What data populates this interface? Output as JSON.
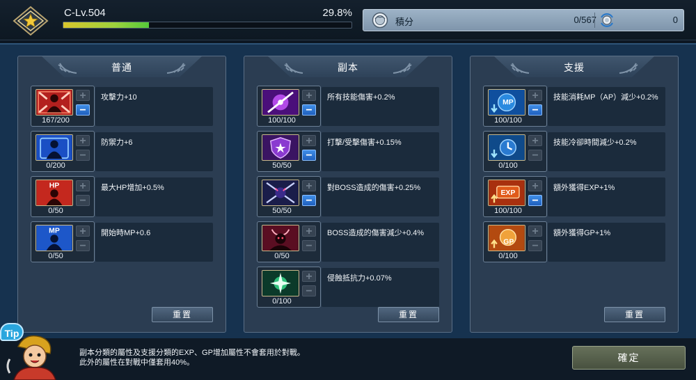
{
  "header": {
    "level_label": "C-Lv.504",
    "exp_percent_label": "29.8%",
    "exp_progress": 0.298,
    "points_label": "積分",
    "points_value": "0/567",
    "secondary_value": "0"
  },
  "columns": [
    {
      "title": "普通",
      "reset_label": "重置",
      "skills": [
        {
          "icon": "attack-power-icon",
          "count": "167/200",
          "desc": "攻擊力+10",
          "minus_active": true
        },
        {
          "icon": "defense-icon",
          "count": "0/200",
          "desc": "防禦力+6",
          "minus_active": false
        },
        {
          "icon": "max-hp-icon",
          "icon_text": "HP",
          "count": "0/50",
          "desc": "最大HP增加+0.5%",
          "minus_active": false
        },
        {
          "icon": "start-mp-icon",
          "icon_text": "MP",
          "count": "0/50",
          "desc": "開始時MP+0.6",
          "minus_active": false
        }
      ]
    },
    {
      "title": "副本",
      "reset_label": "重置",
      "skills": [
        {
          "icon": "all-skill-damage-icon",
          "count": "100/100",
          "desc": "所有技能傷害+0.2%",
          "minus_active": true
        },
        {
          "icon": "hit-damage-shield-icon",
          "count": "50/50",
          "desc": "打擊/受擊傷害+0.15%",
          "minus_active": true
        },
        {
          "icon": "boss-damage-icon",
          "count": "50/50",
          "desc": "對BOSS造成的傷害+0.25%",
          "minus_active": true
        },
        {
          "icon": "boss-damage-reduce-icon",
          "count": "0/50",
          "desc": "BOSS造成的傷害減少+0.4%",
          "minus_active": false
        },
        {
          "icon": "corrosion-resist-icon",
          "count": "0/100",
          "desc": "侵蝕抵抗力+0.07%",
          "minus_active": false
        }
      ]
    },
    {
      "title": "支援",
      "reset_label": "重置",
      "skills": [
        {
          "icon": "mp-cost-reduce-icon",
          "icon_text": "MP",
          "count": "100/100",
          "desc": "技能消耗MP（AP）減少+0.2%",
          "minus_active": true
        },
        {
          "icon": "cooldown-reduce-icon",
          "count": "0/100",
          "desc": "技能冷卻時間減少+0.2%",
          "minus_active": false
        },
        {
          "icon": "bonus-exp-icon",
          "icon_text": "EXP",
          "count": "100/100",
          "desc": "額外獲得EXP+1%",
          "minus_active": true
        },
        {
          "icon": "bonus-gp-icon",
          "icon_text": "GP",
          "count": "0/100",
          "desc": "額外獲得GP+1%",
          "minus_active": false
        }
      ]
    }
  ],
  "footer": {
    "tip_badge": "Tip",
    "tip_line1": "副本分類的屬性及支援分類的EXP、GP增加屬性不會套用於對戰。",
    "tip_line2": "此外的屬性在對戰中僅套用40%。",
    "confirm_label": "確定"
  }
}
